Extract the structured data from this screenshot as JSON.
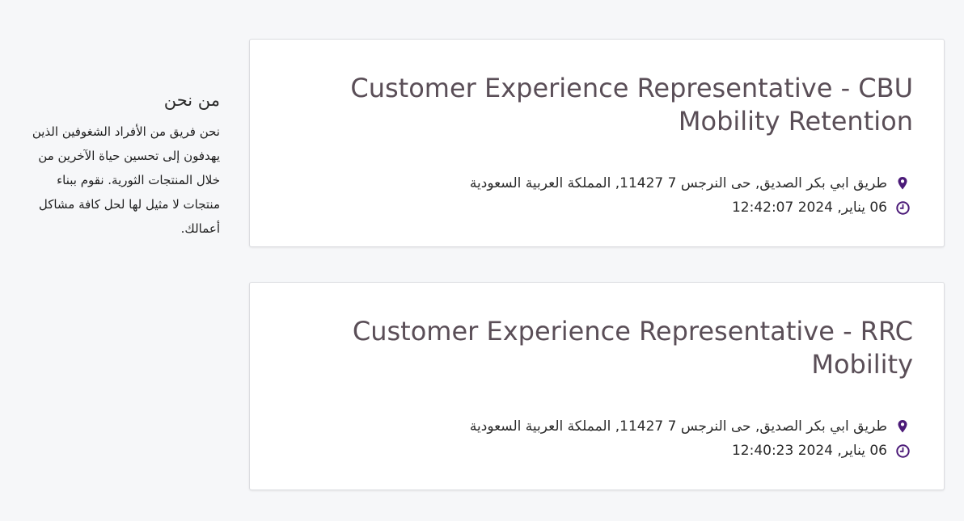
{
  "about": {
    "title": "من نحن",
    "body": "نحن فريق من الأفراد الشغوفين الذين يهدفون إلى تحسين حياة الآخرين من خلال المنتجات الثورية. نقوم ببناء منتجات لا مثيل لها لحل كافة مشاكل أعمالك."
  },
  "jobs": [
    {
      "title": "Customer Experience Representative - CBU Mobility Retention",
      "location": "طريق ابي بكر الصديق, حى النرجس 7 11427, المملكة العربية السعودية",
      "date": "06 يناير, 2024 12:42:07"
    },
    {
      "title": "Customer Experience Representative - RRC Mobility",
      "location": "طريق ابي بكر الصديق, حى النرجس 7 11427, المملكة العربية السعودية",
      "date": "06 يناير, 2024 12:40:23"
    }
  ],
  "icons": {
    "location": "map-pin-icon",
    "time": "clock-icon"
  },
  "colors": {
    "accent": "#4b1a78",
    "title": "#5a4e57",
    "background": "#f6f7f9"
  }
}
